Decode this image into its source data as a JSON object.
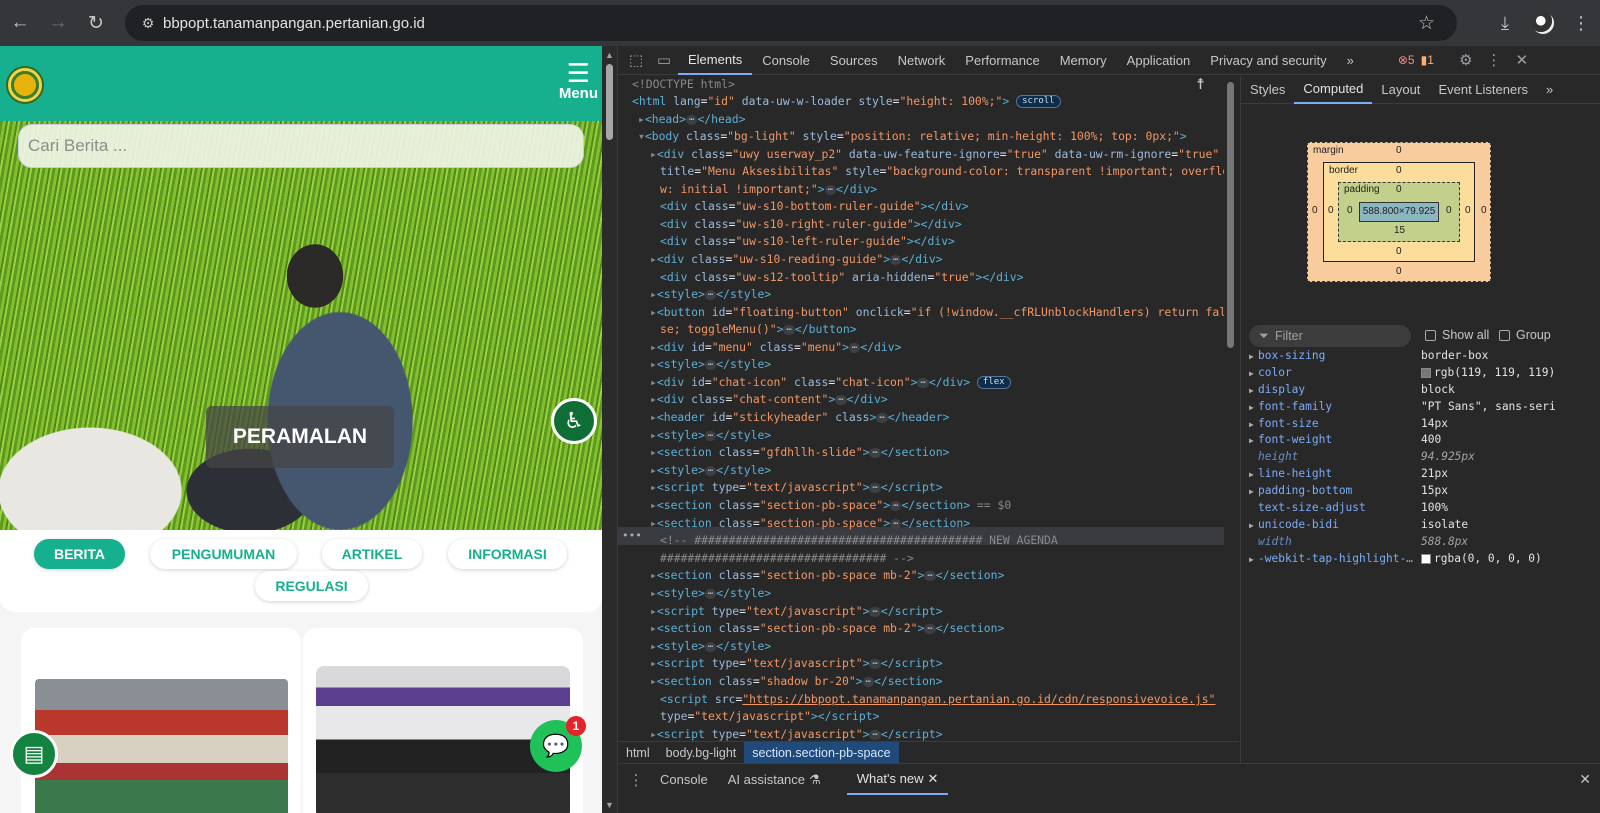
{
  "browser": {
    "url": "bbpopt.tanamanpangan.pertanian.go.id",
    "back_icon": "←",
    "forward_icon": "→",
    "reload_icon": "↻"
  },
  "site": {
    "menu_label": "Menu",
    "search_placeholder": "Cari Berita ...",
    "hero_caption": "PERAMALAN",
    "tabs": [
      "BERITA",
      "PENGUMUMAN",
      "ARTIKEL",
      "INFORMASI",
      "REGULASI"
    ],
    "chat_badge": "1",
    "brand_color": "#16b08f"
  },
  "devtools": {
    "tabs": [
      "Elements",
      "Console",
      "Sources",
      "Network",
      "Performance",
      "Memory",
      "Application",
      "Privacy and security"
    ],
    "more": "»",
    "errors": "5",
    "warnings": "1",
    "breadcrumbs": [
      "html",
      "body.bg-light",
      "section.section-pb-space"
    ],
    "side_tabs": [
      "Styles",
      "Computed",
      "Layout",
      "Event Listeners"
    ],
    "box_model": {
      "margin_label": "margin",
      "border_label": "border",
      "padding_label": "padding",
      "content": "588.800×79.925",
      "margin": [
        "0",
        "0",
        "0",
        "0"
      ],
      "border": [
        "0",
        "0",
        "0",
        "0"
      ],
      "padding": [
        "0",
        "0",
        "15",
        "0"
      ]
    },
    "filter_placeholder": "Filter",
    "show_all": "Show all",
    "group": "Group",
    "computed": [
      {
        "name": "box-sizing",
        "value": "border-box"
      },
      {
        "name": "color",
        "value": "rgb(119, 119, 119)"
      },
      {
        "name": "display",
        "value": "block"
      },
      {
        "name": "font-family",
        "value": "\"PT Sans\", sans-seri"
      },
      {
        "name": "font-size",
        "value": "14px"
      },
      {
        "name": "font-weight",
        "value": "400"
      },
      {
        "name": "height",
        "value": "94.925px"
      },
      {
        "name": "line-height",
        "value": "21px"
      },
      {
        "name": "padding-bottom",
        "value": "15px"
      },
      {
        "name": "text-size-adjust",
        "value": "100%"
      },
      {
        "name": "unicode-bidi",
        "value": "isolate"
      },
      {
        "name": "width",
        "value": "588.8px"
      },
      {
        "name": "-webkit-tap-highlight-…",
        "value": "rgba(0, 0, 0, 0)"
      }
    ],
    "drawer_tabs": [
      "Console",
      "AI assistance",
      "What's new"
    ],
    "selected_marker": "== $0"
  }
}
